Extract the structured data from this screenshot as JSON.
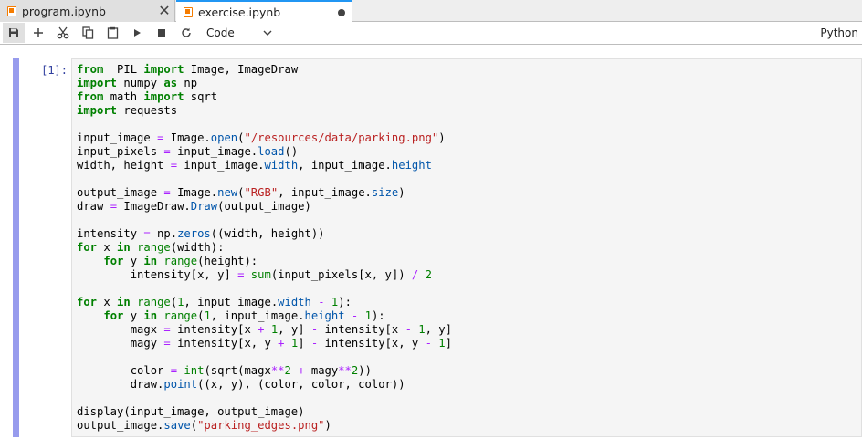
{
  "tabs": [
    {
      "label": "program.ipynb",
      "active": false
    },
    {
      "label": "exercise.ipynb",
      "active": true
    }
  ],
  "toolbar": {
    "cell_type": "Code",
    "kernel": "Python",
    "icons": [
      "save-icon",
      "add-cell-icon",
      "cut-icon",
      "copy-icon",
      "paste-icon",
      "run-icon",
      "stop-icon",
      "restart-icon",
      "chevron-down-icon"
    ]
  },
  "cell": {
    "prompt": "[1]:",
    "lines": [
      [
        [
          "kw",
          "from"
        ],
        [
          "",
          "  PIL "
        ],
        [
          "kw",
          "import"
        ],
        [
          "",
          " Image, ImageDraw"
        ]
      ],
      [
        [
          "kw",
          "import"
        ],
        [
          "",
          " numpy "
        ],
        [
          "kw",
          "as"
        ],
        [
          "",
          " np"
        ]
      ],
      [
        [
          "kw",
          "from"
        ],
        [
          "",
          " math "
        ],
        [
          "kw",
          "import"
        ],
        [
          "",
          " sqrt"
        ]
      ],
      [
        [
          "kw",
          "import"
        ],
        [
          "",
          " requests"
        ]
      ],
      [],
      [
        [
          "",
          "input_image "
        ],
        [
          "op",
          "="
        ],
        [
          "",
          " Image."
        ],
        [
          "attr",
          "open"
        ],
        [
          "",
          "("
        ],
        [
          "str",
          "\"/resources/data/parking.png\""
        ],
        [
          "",
          ")"
        ]
      ],
      [
        [
          "",
          "input_pixels "
        ],
        [
          "op",
          "="
        ],
        [
          "",
          " input_image."
        ],
        [
          "attr",
          "load"
        ],
        [
          "",
          "()"
        ]
      ],
      [
        [
          "",
          "width, height "
        ],
        [
          "op",
          "="
        ],
        [
          "",
          " input_image."
        ],
        [
          "attr",
          "width"
        ],
        [
          "",
          ", input_image."
        ],
        [
          "attr",
          "height"
        ]
      ],
      [],
      [
        [
          "",
          "output_image "
        ],
        [
          "op",
          "="
        ],
        [
          "",
          " Image."
        ],
        [
          "attr",
          "new"
        ],
        [
          "",
          "("
        ],
        [
          "str",
          "\"RGB\""
        ],
        [
          "",
          ", input_image."
        ],
        [
          "attr",
          "size"
        ],
        [
          "",
          ")"
        ]
      ],
      [
        [
          "",
          "draw "
        ],
        [
          "op",
          "="
        ],
        [
          "",
          " ImageDraw."
        ],
        [
          "attr",
          "Draw"
        ],
        [
          "",
          "(output_image)"
        ]
      ],
      [],
      [
        [
          "",
          "intensity "
        ],
        [
          "op",
          "="
        ],
        [
          "",
          " np."
        ],
        [
          "attr",
          "zeros"
        ],
        [
          "",
          "((width, height))"
        ]
      ],
      [
        [
          "kw",
          "for"
        ],
        [
          "",
          " x "
        ],
        [
          "kw",
          "in"
        ],
        [
          "",
          " "
        ],
        [
          "bi",
          "range"
        ],
        [
          "",
          "(width):"
        ]
      ],
      [
        [
          "",
          "    "
        ],
        [
          "kw",
          "for"
        ],
        [
          "",
          " y "
        ],
        [
          "kw",
          "in"
        ],
        [
          "",
          " "
        ],
        [
          "bi",
          "range"
        ],
        [
          "",
          "(height):"
        ]
      ],
      [
        [
          "",
          "        intensity[x, y] "
        ],
        [
          "op",
          "="
        ],
        [
          "",
          " "
        ],
        [
          "bi",
          "sum"
        ],
        [
          "",
          "(input_pixels[x, y]) "
        ],
        [
          "op",
          "/"
        ],
        [
          "",
          " "
        ],
        [
          "num",
          "2"
        ]
      ],
      [],
      [
        [
          "kw",
          "for"
        ],
        [
          "",
          " x "
        ],
        [
          "kw",
          "in"
        ],
        [
          "",
          " "
        ],
        [
          "bi",
          "range"
        ],
        [
          "",
          "("
        ],
        [
          "num",
          "1"
        ],
        [
          "",
          ", input_image."
        ],
        [
          "attr",
          "width"
        ],
        [
          "",
          " "
        ],
        [
          "op",
          "-"
        ],
        [
          "",
          " "
        ],
        [
          "num",
          "1"
        ],
        [
          "",
          "):"
        ]
      ],
      [
        [
          "",
          "    "
        ],
        [
          "kw",
          "for"
        ],
        [
          "",
          " y "
        ],
        [
          "kw",
          "in"
        ],
        [
          "",
          " "
        ],
        [
          "bi",
          "range"
        ],
        [
          "",
          "("
        ],
        [
          "num",
          "1"
        ],
        [
          "",
          ", input_image."
        ],
        [
          "attr",
          "height"
        ],
        [
          "",
          " "
        ],
        [
          "op",
          "-"
        ],
        [
          "",
          " "
        ],
        [
          "num",
          "1"
        ],
        [
          "",
          "):"
        ]
      ],
      [
        [
          "",
          "        magx "
        ],
        [
          "op",
          "="
        ],
        [
          "",
          " intensity[x "
        ],
        [
          "op",
          "+"
        ],
        [
          "",
          " "
        ],
        [
          "num",
          "1"
        ],
        [
          "",
          ", y] "
        ],
        [
          "op",
          "-"
        ],
        [
          "",
          " intensity[x "
        ],
        [
          "op",
          "-"
        ],
        [
          "",
          " "
        ],
        [
          "num",
          "1"
        ],
        [
          "",
          ", y]"
        ]
      ],
      [
        [
          "",
          "        magy "
        ],
        [
          "op",
          "="
        ],
        [
          "",
          " intensity[x, y "
        ],
        [
          "op",
          "+"
        ],
        [
          "",
          " "
        ],
        [
          "num",
          "1"
        ],
        [
          "",
          "] "
        ],
        [
          "op",
          "-"
        ],
        [
          "",
          " intensity[x, y "
        ],
        [
          "op",
          "-"
        ],
        [
          "",
          " "
        ],
        [
          "num",
          "1"
        ],
        [
          "",
          "]"
        ]
      ],
      [],
      [
        [
          "",
          "        color "
        ],
        [
          "op",
          "="
        ],
        [
          "",
          " "
        ],
        [
          "bi",
          "int"
        ],
        [
          "",
          "(sqrt(magx"
        ],
        [
          "op",
          "**"
        ],
        [
          "num",
          "2"
        ],
        [
          "",
          " "
        ],
        [
          "op",
          "+"
        ],
        [
          "",
          " magy"
        ],
        [
          "op",
          "**"
        ],
        [
          "num",
          "2"
        ],
        [
          "",
          "))"
        ]
      ],
      [
        [
          "",
          "        draw."
        ],
        [
          "attr",
          "point"
        ],
        [
          "",
          "((x, y), (color, color, color))"
        ]
      ],
      [],
      [
        [
          "",
          "display(input_image, output_image)"
        ]
      ],
      [
        [
          "",
          "output_image."
        ],
        [
          "attr",
          "save"
        ],
        [
          "",
          "("
        ],
        [
          "str",
          "\"parking_edges.png\""
        ],
        [
          "",
          ")"
        ]
      ]
    ]
  }
}
